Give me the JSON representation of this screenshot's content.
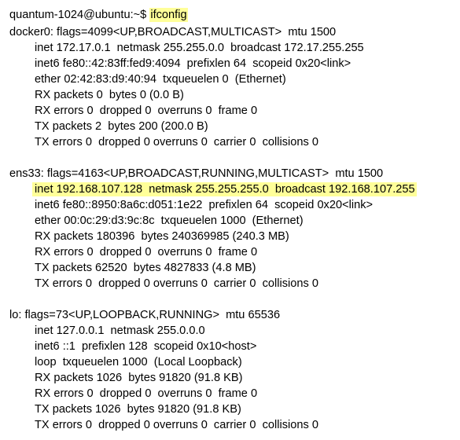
{
  "terminal": {
    "prompt": "quantum-1024@ubuntu:~$",
    "command": "ifconfig",
    "highlight_color": "#ffff99",
    "docker0": {
      "header": "docker0: flags=4099<UP,BROADCAST,MULTICAST>  mtu 1500",
      "inet": "inet 172.17.0.1  netmask 255.255.0.0  broadcast 172.17.255.255",
      "inet6": "inet6 fe80::42:83ff:fed9:4094  prefixlen 64  scopeid 0x20<link>",
      "ether": "ether 02:42:83:d9:40:94  txqueuelen 0  (Ethernet)",
      "rx_packets": "RX packets 0  bytes 0 (0.0 B)",
      "rx_errors": "RX errors 0  dropped 0  overruns 0  frame 0",
      "tx_packets": "TX packets 2  bytes 200 (200.0 B)",
      "tx_errors": "TX errors 0  dropped 0 overruns 0  carrier 0  collisions 0"
    },
    "ens33": {
      "header": "ens33: flags=4163<UP,BROADCAST,RUNNING,MULTICAST>  mtu 1500",
      "inet": "inet 192.168.107.128  netmask 255.255.255.0  broadcast 192.168.107.255",
      "inet6": "inet6 fe80::8950:8a6c:d051:1e22  prefixlen 64  scopeid 0x20<link>",
      "ether": "ether 00:0c:29:d3:9c:8c  txqueuelen 1000  (Ethernet)",
      "rx_packets": "RX packets 180396  bytes 240369985 (240.3 MB)",
      "rx_errors": "RX errors 0  dropped 0  overruns 0  frame 0",
      "tx_packets": "TX packets 62520  bytes 4827833 (4.8 MB)",
      "tx_errors": "TX errors 0  dropped 0 overruns 0  carrier 0  collisions 0"
    },
    "lo": {
      "header": "lo: flags=73<UP,LOOPBACK,RUNNING>  mtu 65536",
      "inet": "inet 127.0.0.1  netmask 255.0.0.0",
      "inet6": "inet6 ::1  prefixlen 128  scopeid 0x10<host>",
      "loop": "loop  txqueuelen 1000  (Local Loopback)",
      "rx_packets": "RX packets 1026  bytes 91820 (91.8 KB)",
      "rx_errors": "RX errors 0  dropped 0  overruns 0  frame 0",
      "tx_packets": "TX packets 1026  bytes 91820 (91.8 KB)",
      "tx_errors": "TX errors 0  dropped 0 overruns 0  carrier 0  collisions 0"
    }
  }
}
